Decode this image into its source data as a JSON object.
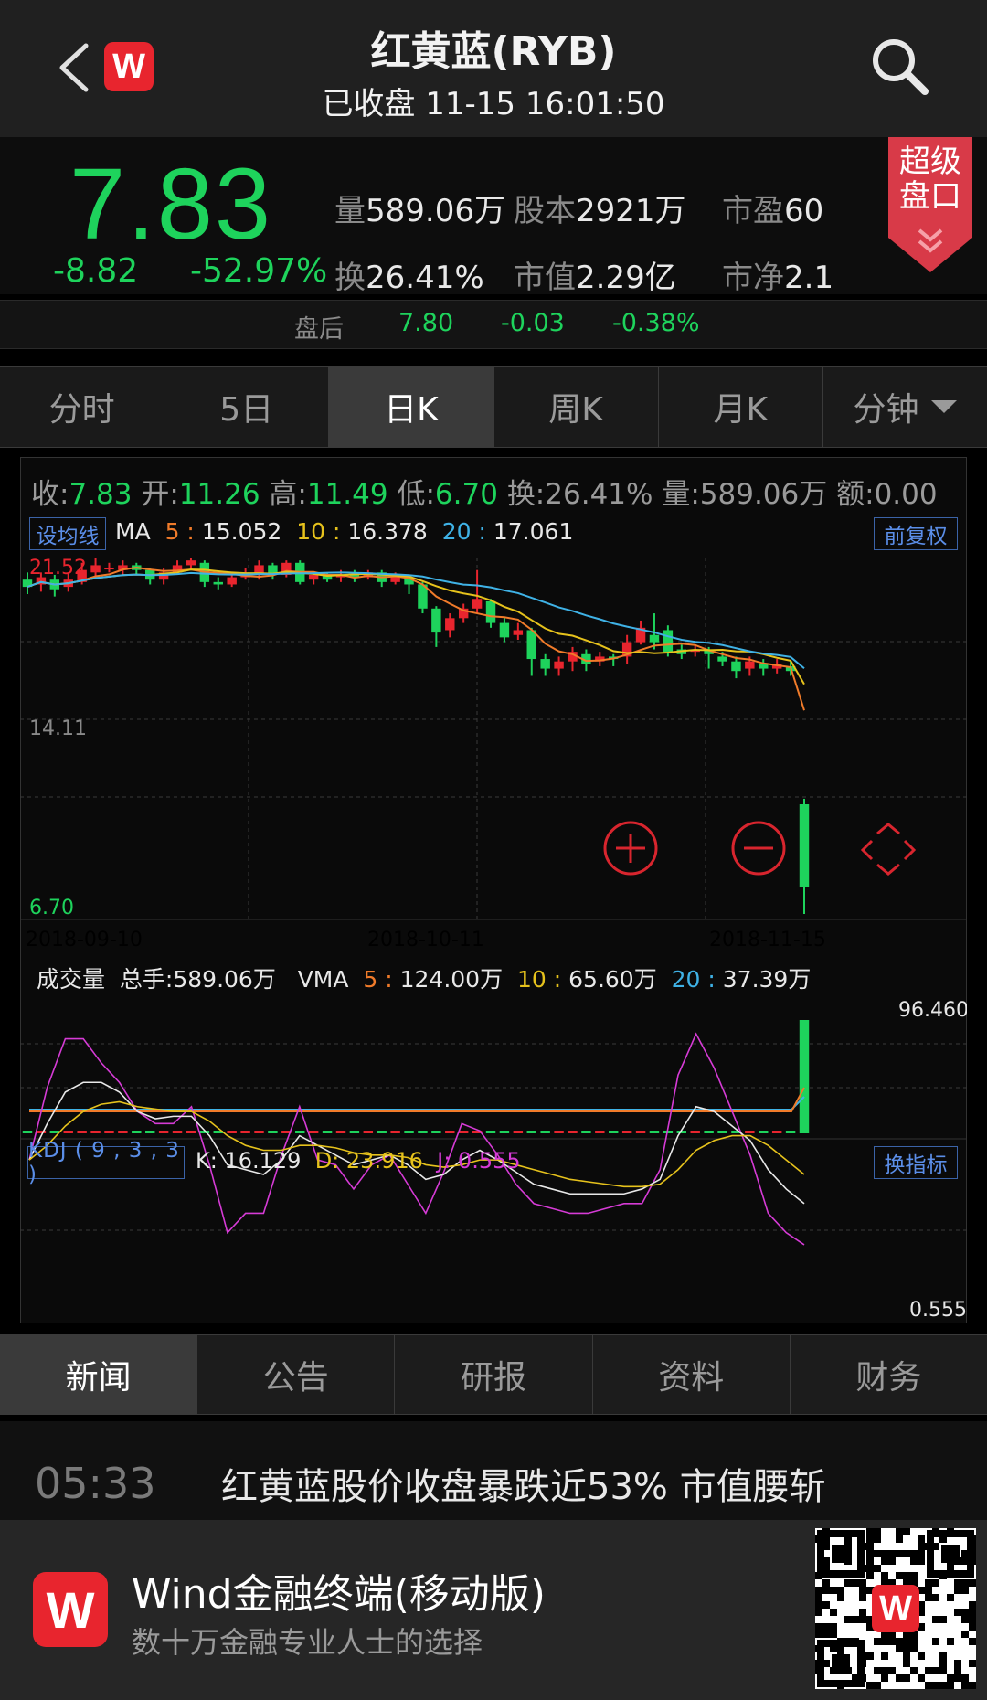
{
  "header": {
    "title": "红黄蓝(RYB)",
    "status": "已收盘 11-15 16:01:50",
    "logo_letter": "W"
  },
  "quote": {
    "price": "7.83",
    "change": "-8.82",
    "change_pct": "-52.97%",
    "volume_label": "量",
    "volume": "589.06万",
    "share_label": "股本",
    "share": "2921万",
    "pe_label": "市盈",
    "pe": "60",
    "turnover_label": "换",
    "turnover": "26.41%",
    "mcap_label": "市值",
    "mcap": "2.29亿",
    "pb_label": "市净",
    "pb": "2.1",
    "super_label_1": "超级",
    "super_label_2": "盘口",
    "after_label": "盘后",
    "after_price": "7.80",
    "after_change": "-0.03",
    "after_pct": "-0.38%"
  },
  "period_tabs": [
    {
      "label": "分时"
    },
    {
      "label": "5日"
    },
    {
      "label": "日K"
    },
    {
      "label": "周K"
    },
    {
      "label": "月K"
    },
    {
      "label": "分钟"
    }
  ],
  "ohlc": {
    "close_k": "收:",
    "close": "7.83",
    "open_k": "开:",
    "open": "11.26",
    "high_k": "高:",
    "high": "11.49",
    "low_k": "低:",
    "low": "6.70",
    "turn_k": "换:",
    "turn": "26.41%",
    "vol_k": "量:",
    "vol": "589.06万",
    "amt_k": "额:",
    "amt": "0.00"
  },
  "ma": {
    "button": "设均线",
    "label": "MA",
    "p5": "5",
    "v5": "15.052",
    "p10": "10",
    "v10": "16.378",
    "p20": "20",
    "v20": "17.061",
    "adjust_button": "前复权"
  },
  "axis": {
    "y_top": "21.52",
    "y_mid": "14.11",
    "y_bottom": "6.70",
    "x_left": "2018-09-10",
    "x_mid": "2018-10-11",
    "x_right": "2018-11-15"
  },
  "volume_panel": {
    "label": "成交量",
    "total_label": "总手:",
    "total": "589.06万",
    "vma_label": "VMA",
    "p5": "5",
    "v5": "124.00万",
    "p10": "10",
    "v10": "65.60万",
    "p20": "20",
    "v20": "37.39万"
  },
  "kdj_panel": {
    "button": "KDJ ( 9 , 3 , 3 )",
    "k": "K: 16.129",
    "d": "D: 23.916",
    "j": "J: 0.555",
    "switch_button": "换指标",
    "max": "96.460",
    "min": "0.555"
  },
  "bottom_tabs": [
    {
      "label": "新闻"
    },
    {
      "label": "公告"
    },
    {
      "label": "研报"
    },
    {
      "label": "资料"
    },
    {
      "label": "财务"
    }
  ],
  "news": {
    "time": "05:33",
    "title": "红黄蓝股价收盘暴跌近53% 市值腰斩"
  },
  "promo": {
    "title": "Wind金融终端(移动版)",
    "subtitle": "数十万金融专业人士的选择"
  },
  "colors": {
    "up": "#e8252e",
    "down": "#1ed35c",
    "ma5": "#f07b2a",
    "ma10": "#e6c21c",
    "ma20": "#3fb2e6",
    "kdj_j": "#d63bd6"
  },
  "icons": [
    "back-arrow-icon",
    "wind-logo-icon",
    "search-icon",
    "zoom-in-icon",
    "zoom-out-icon",
    "move-icon",
    "dropdown-caret-icon",
    "qr-code-icon"
  ],
  "chart_data": {
    "type": "candlestick",
    "ylim": [
      6.7,
      21.52
    ],
    "x_ticks": [
      "2018-09-10",
      "2018-10-11",
      "2018-11-15"
    ],
    "last_candle": {
      "open": 11.26,
      "high": 11.49,
      "low": 6.7,
      "close": 7.83
    },
    "candles": [
      [
        20.6,
        20.3,
        20.9,
        20.0
      ],
      [
        20.4,
        20.7,
        20.9,
        20.1
      ],
      [
        20.6,
        20.2,
        20.8,
        19.9
      ],
      [
        20.3,
        20.6,
        20.9,
        20.1
      ],
      [
        20.5,
        21.0,
        21.3,
        20.4
      ],
      [
        20.9,
        21.2,
        21.5,
        20.7
      ],
      [
        21.1,
        21.1,
        21.3,
        20.9
      ],
      [
        21.0,
        21.2,
        21.4,
        20.8
      ],
      [
        21.2,
        21.0,
        21.3,
        20.8
      ],
      [
        21.0,
        20.6,
        21.1,
        20.4
      ],
      [
        20.6,
        20.9,
        21.1,
        20.4
      ],
      [
        20.9,
        21.2,
        21.4,
        20.8
      ],
      [
        21.2,
        21.4,
        21.5,
        21.0
      ],
      [
        21.3,
        20.5,
        21.4,
        20.3
      ],
      [
        20.5,
        20.4,
        20.7,
        20.2
      ],
      [
        20.4,
        20.7,
        20.9,
        20.3
      ],
      [
        20.7,
        20.8,
        21.1,
        20.6
      ],
      [
        20.8,
        21.2,
        21.4,
        20.6
      ],
      [
        21.2,
        20.8,
        21.3,
        20.6
      ],
      [
        20.8,
        21.3,
        21.4,
        20.7
      ],
      [
        21.3,
        20.5,
        21.4,
        20.4
      ],
      [
        20.6,
        20.8,
        20.9,
        20.4
      ],
      [
        20.8,
        20.6,
        20.9,
        20.5
      ],
      [
        20.7,
        20.8,
        21.0,
        20.5
      ],
      [
        20.8,
        20.7,
        21.0,
        20.5
      ],
      [
        20.7,
        20.9,
        21.0,
        20.6
      ],
      [
        20.9,
        20.5,
        21.0,
        20.3
      ],
      [
        20.5,
        20.8,
        20.9,
        20.4
      ],
      [
        20.7,
        20.4,
        20.8,
        20.0
      ],
      [
        20.4,
        19.4,
        20.5,
        19.2
      ],
      [
        19.4,
        18.4,
        19.5,
        17.8
      ],
      [
        18.5,
        19.0,
        19.2,
        18.2
      ],
      [
        19.0,
        19.4,
        19.6,
        18.8
      ],
      [
        19.4,
        19.8,
        21.0,
        19.2
      ],
      [
        19.7,
        18.8,
        19.8,
        18.6
      ],
      [
        18.8,
        18.2,
        19.0,
        18.0
      ],
      [
        18.3,
        18.5,
        18.8,
        18.1
      ],
      [
        18.5,
        17.3,
        18.6,
        16.6
      ],
      [
        17.3,
        16.9,
        17.5,
        16.6
      ],
      [
        16.9,
        17.2,
        17.4,
        16.6
      ],
      [
        17.2,
        17.6,
        17.8,
        16.8
      ],
      [
        17.5,
        17.1,
        17.7,
        16.8
      ],
      [
        17.2,
        17.4,
        17.6,
        17.0
      ],
      [
        17.4,
        17.3,
        17.5,
        17.0
      ],
      [
        17.4,
        18.0,
        18.3,
        17.1
      ],
      [
        18.0,
        18.6,
        18.9,
        17.9
      ],
      [
        18.3,
        18.0,
        19.2,
        17.7
      ],
      [
        18.5,
        17.6,
        18.7,
        17.4
      ],
      [
        17.7,
        17.5,
        17.9,
        17.3
      ],
      [
        17.6,
        17.7,
        17.9,
        17.4
      ],
      [
        17.7,
        17.5,
        17.8,
        16.9
      ],
      [
        17.4,
        17.2,
        17.6,
        17.0
      ],
      [
        17.2,
        16.8,
        17.4,
        16.5
      ],
      [
        16.9,
        17.2,
        17.4,
        16.6
      ],
      [
        17.1,
        16.9,
        17.3,
        16.6
      ],
      [
        16.9,
        17.1,
        17.3,
        16.7
      ],
      [
        17.0,
        16.8,
        17.2,
        16.6
      ],
      [
        11.26,
        7.83,
        11.49,
        6.7
      ]
    ]
  }
}
